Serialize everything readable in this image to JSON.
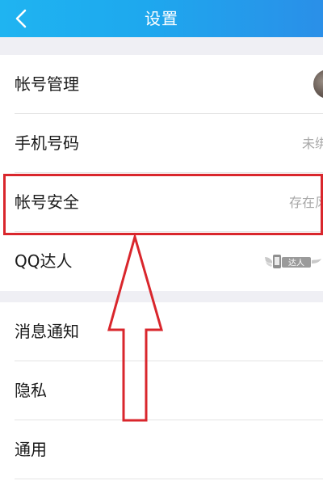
{
  "header": {
    "title": "设置",
    "back_icon": "chevron-left-icon"
  },
  "group_account": {
    "items": [
      {
        "label": "帐号管理",
        "value": ""
      },
      {
        "label": "手机号码",
        "value": "未绑"
      },
      {
        "label": "帐号安全",
        "value": "存在风"
      },
      {
        "label": "QQ达人",
        "value": ""
      }
    ]
  },
  "badge": {
    "text": "达人"
  },
  "group_general": {
    "items": [
      {
        "label": "消息通知"
      },
      {
        "label": "隐私"
      },
      {
        "label": "通用"
      }
    ]
  },
  "colors": {
    "header_start": "#1fb4f1",
    "header_end": "#2a8fe8",
    "annotation_red": "#d9262c",
    "background": "#efeff4"
  }
}
